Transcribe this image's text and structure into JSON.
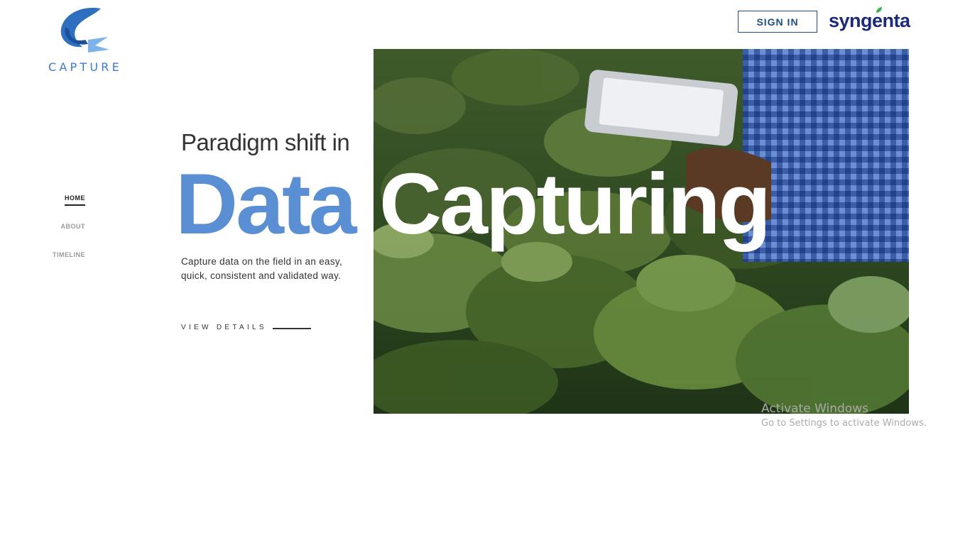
{
  "logo": {
    "name": "CAPTURE",
    "icon": "leaf-logo-icon"
  },
  "header": {
    "signin_label": "SIGN IN",
    "brand": "syngenta",
    "brand_icon": "syngenta-leaf-icon"
  },
  "nav": {
    "items": [
      "HOME",
      "ABOUT",
      "TIMELINE"
    ],
    "active": "HOME"
  },
  "hero": {
    "lead": "Paradigm shift in",
    "word1": "Data",
    "word2": "Capturing",
    "description": "Capture data on the field in an easy, quick, consistent and validated way.",
    "cta": "VIEW DETAILS",
    "image": "field-tablet-photo"
  },
  "watermark": {
    "title": "Activate Windows",
    "subtitle": "Go to Settings to activate Windows."
  },
  "colors": {
    "accent_blue": "#5b8fd4",
    "brand_navy": "#1b2a7a",
    "signin_border": "#214d86",
    "leaf_green": "#39b54a"
  }
}
